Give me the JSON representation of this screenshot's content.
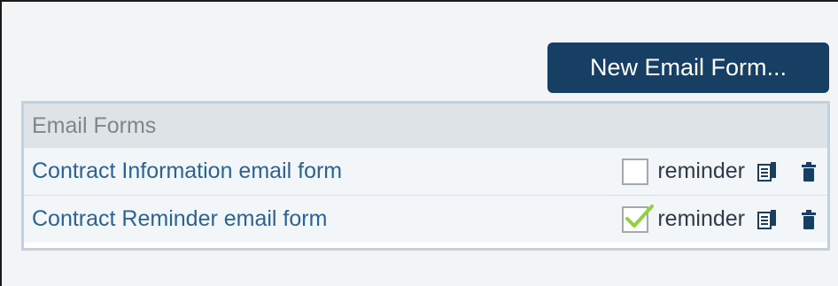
{
  "toolbar": {
    "new_email_form_label": "New Email Form..."
  },
  "panel": {
    "header": "Email Forms",
    "rows": [
      {
        "name": "Contract Information email form",
        "reminder_label": "reminder",
        "reminder_checked": false
      },
      {
        "name": "Contract Reminder email form",
        "reminder_label": "reminder",
        "reminder_checked": true
      }
    ]
  },
  "icons": {
    "copy": "copy-icon",
    "delete": "trash-icon",
    "check": "check-icon"
  },
  "colors": {
    "button_bg": "#163f63",
    "link_text": "#2d6392",
    "check_green": "#8fd23a"
  }
}
